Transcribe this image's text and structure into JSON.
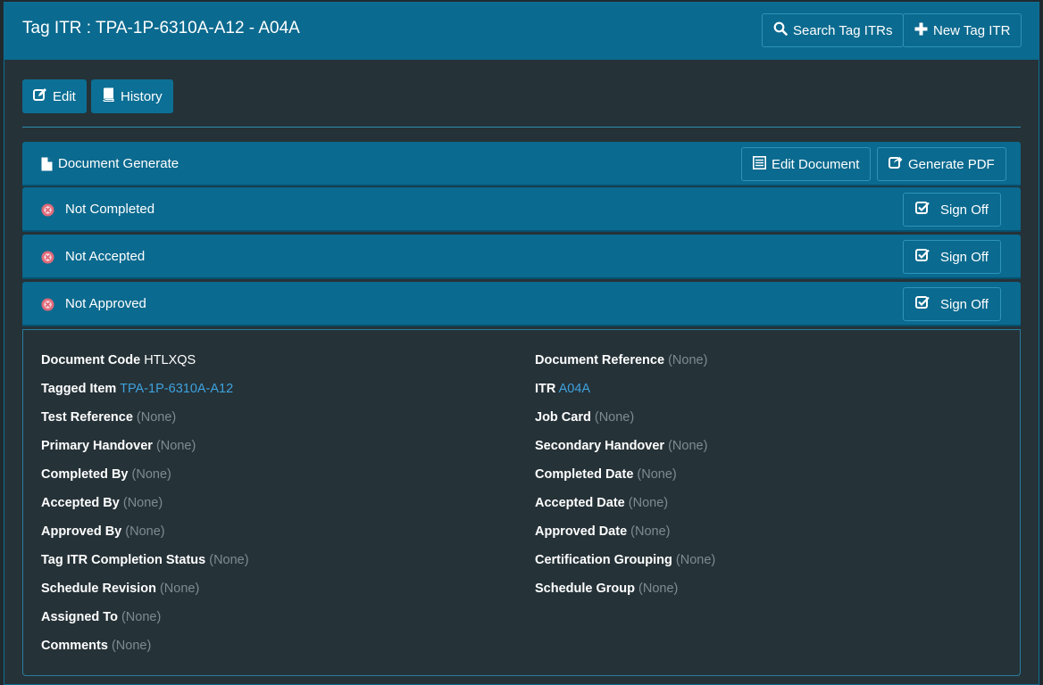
{
  "header": {
    "title": "Tag ITR : TPA-1P-6310A-A12 - A04A",
    "search_label": "Search Tag ITRs",
    "new_label": "New Tag ITR"
  },
  "toolbar": {
    "edit_label": "Edit",
    "history_label": "History"
  },
  "document_panel": {
    "label": "Document Generate",
    "edit_document_label": "Edit Document",
    "generate_pdf_label": "Generate PDF"
  },
  "status_panels": [
    {
      "label": "Not Completed",
      "action": "Sign Off"
    },
    {
      "label": "Not Accepted",
      "action": "Sign Off"
    },
    {
      "label": "Not Approved",
      "action": "Sign Off"
    }
  ],
  "details": {
    "left": [
      {
        "label": "Document Code",
        "value": "HTLXQS",
        "kind": "text"
      },
      {
        "label": "Tagged Item",
        "value": "TPA-1P-6310A-A12",
        "kind": "link"
      },
      {
        "label": "Test Reference",
        "value": "(None)",
        "kind": "none"
      },
      {
        "label": "Primary Handover",
        "value": "(None)",
        "kind": "none"
      },
      {
        "label": "Completed By",
        "value": "(None)",
        "kind": "none"
      },
      {
        "label": "Accepted By",
        "value": "(None)",
        "kind": "none"
      },
      {
        "label": "Approved By",
        "value": "(None)",
        "kind": "none"
      },
      {
        "label": "Tag ITR Completion Status",
        "value": "(None)",
        "kind": "none"
      },
      {
        "label": "Schedule Revision",
        "value": "(None)",
        "kind": "none"
      },
      {
        "label": "Assigned To",
        "value": "(None)",
        "kind": "none"
      },
      {
        "label": "Comments",
        "value": "(None)",
        "kind": "none"
      }
    ],
    "right": [
      {
        "label": "Document Reference",
        "value": "(None)",
        "kind": "none"
      },
      {
        "label": "ITR",
        "value": "A04A",
        "kind": "link"
      },
      {
        "label": "Job Card",
        "value": "(None)",
        "kind": "none"
      },
      {
        "label": "Secondary Handover",
        "value": "(None)",
        "kind": "none"
      },
      {
        "label": "Completed Date",
        "value": "(None)",
        "kind": "none"
      },
      {
        "label": "Accepted Date",
        "value": "(None)",
        "kind": "none"
      },
      {
        "label": "Approved Date",
        "value": "(None)",
        "kind": "none"
      },
      {
        "label": "Certification Grouping",
        "value": "(None)",
        "kind": "none"
      },
      {
        "label": "Schedule Group",
        "value": "(None)",
        "kind": "none"
      }
    ]
  },
  "colors": {
    "header_bg": "#0b6a8f",
    "page_bg": "#253238",
    "link": "#3ea2dd",
    "muted": "#7f8b90",
    "status_icon": "#e06a7a"
  },
  "icons": {
    "search": "search-icon",
    "new": "plus-icon",
    "edit": "edit-icon",
    "history": "book-icon",
    "document": "file-icon",
    "edit_document": "list-icon",
    "generate_pdf": "share-icon",
    "status": "times-circle-icon",
    "sign_off": "check-square-icon"
  }
}
